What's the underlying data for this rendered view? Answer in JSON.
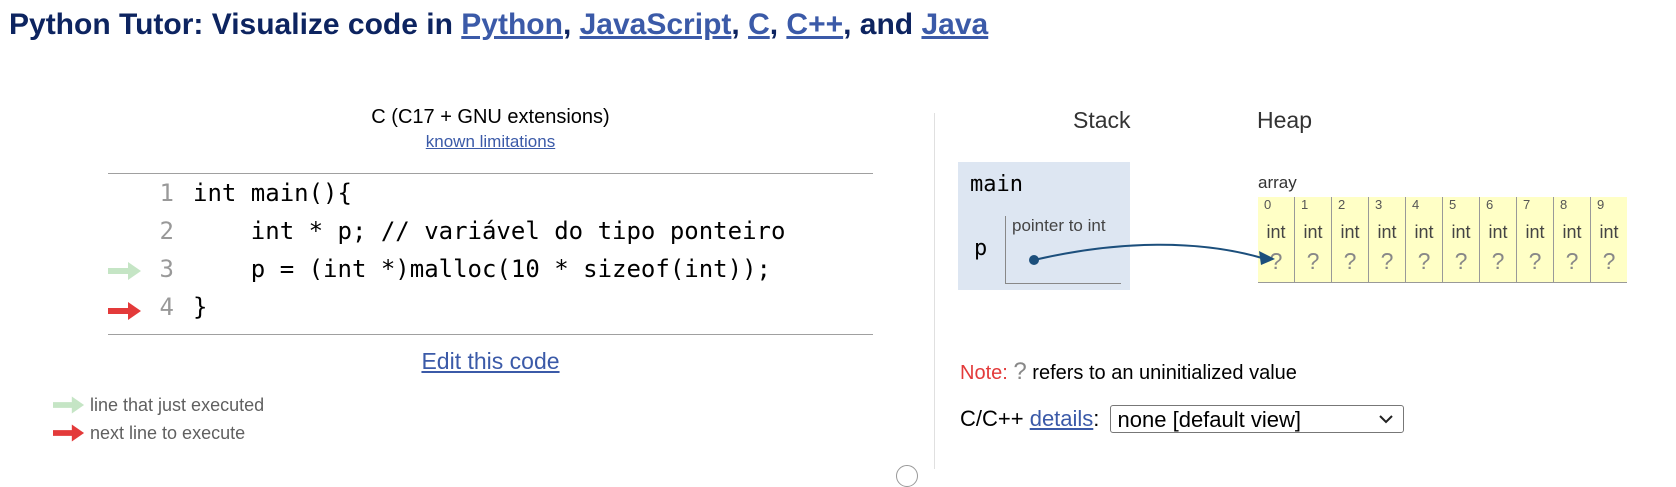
{
  "header": {
    "title_prefix": "Python Tutor: Visualize code in ",
    "languages": [
      "Python",
      "JavaScript",
      "C",
      "C++",
      "Java"
    ],
    "separator": ", ",
    "conjunction": ", and "
  },
  "code_panel": {
    "language_label": "C (C17 + GNU extensions)",
    "known_limitations_link": "known limitations",
    "lines": [
      {
        "number": "1",
        "text": "int main(){"
      },
      {
        "number": "2",
        "text": "    int * p; // variável do tipo ponteiro"
      },
      {
        "number": "3",
        "text": "    p = (int *)malloc(10 * sizeof(int));"
      },
      {
        "number": "4",
        "text": "}"
      }
    ],
    "just_executed_line": 3,
    "next_line": 4,
    "edit_link": "Edit this code"
  },
  "legend": {
    "just_executed": "line that just executed",
    "next_to_execute": "next line to execute"
  },
  "visualization": {
    "stack_header": "Stack",
    "heap_header": "Heap",
    "frame": {
      "name": "main",
      "variable_name": "p",
      "variable_type": "pointer to int"
    },
    "heap_object": {
      "label": "array",
      "cells": [
        {
          "index": "0",
          "type": "int",
          "value": "?"
        },
        {
          "index": "1",
          "type": "int",
          "value": "?"
        },
        {
          "index": "2",
          "type": "int",
          "value": "?"
        },
        {
          "index": "3",
          "type": "int",
          "value": "?"
        },
        {
          "index": "4",
          "type": "int",
          "value": "?"
        },
        {
          "index": "5",
          "type": "int",
          "value": "?"
        },
        {
          "index": "6",
          "type": "int",
          "value": "?"
        },
        {
          "index": "7",
          "type": "int",
          "value": "?"
        },
        {
          "index": "8",
          "type": "int",
          "value": "?"
        },
        {
          "index": "9",
          "type": "int",
          "value": "?"
        }
      ]
    }
  },
  "note": {
    "label": "Note:",
    "symbol": "?",
    "text": " refers to an uninitialized value"
  },
  "options": {
    "prefix": "C/C++ ",
    "link": "details",
    "suffix": ":",
    "selected": "none [default view]"
  },
  "colors": {
    "title": "#0d2460",
    "link": "#3b5aa8",
    "just_executed_arrow": "#c5e5c5",
    "next_line_arrow": "#e33a3a",
    "stack_frame_bg": "#dde6f2",
    "heap_bg": "#ffffc6",
    "pointer_arrow": "#1c4f7c"
  }
}
